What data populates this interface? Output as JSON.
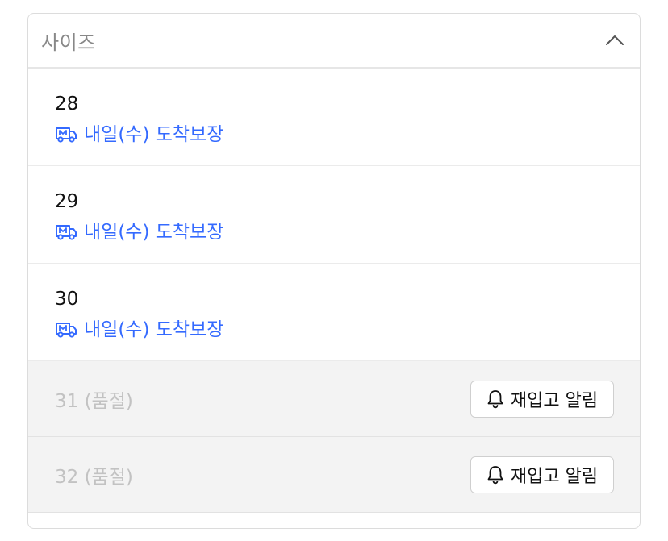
{
  "dropdown": {
    "label": "사이즈",
    "chevron_icon": "chevron-up-icon",
    "accent_color": "#346aff"
  },
  "options": [
    {
      "size": "28",
      "delivery": "내일(수) 도착보장",
      "icon": "rocket-delivery-truck-icon"
    },
    {
      "size": "29",
      "delivery": "내일(수) 도착보장",
      "icon": "rocket-delivery-truck-icon"
    },
    {
      "size": "30",
      "delivery": "내일(수) 도착보장",
      "icon": "rocket-delivery-truck-icon"
    }
  ],
  "soldout_options": [
    {
      "label": "31 (품절)",
      "button_label": "재입고 알림",
      "icon": "bell-icon"
    },
    {
      "label": "32 (품절)",
      "button_label": "재입고 알림",
      "icon": "bell-icon"
    }
  ]
}
